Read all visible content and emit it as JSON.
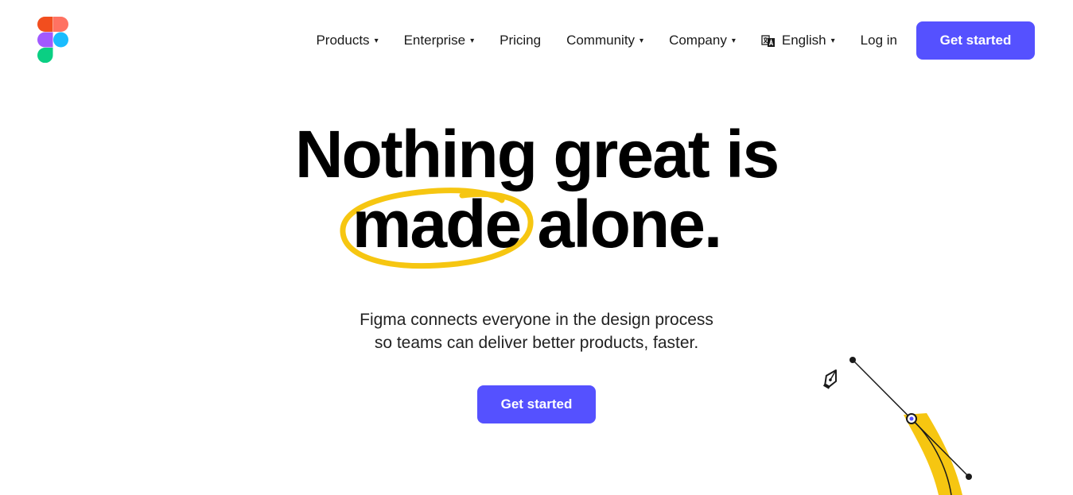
{
  "header": {
    "logo": {
      "name": "figma-logo"
    },
    "nav": {
      "products": "Products",
      "enterprise": "Enterprise",
      "pricing": "Pricing",
      "community": "Community",
      "company": "Company",
      "language": "English",
      "login": "Log in",
      "get_started": "Get started"
    },
    "caret": "▾"
  },
  "hero": {
    "headline_part1": "Nothing great is",
    "headline_circled": "made",
    "headline_part2": "alone.",
    "subtitle_line1": "Figma connects everyone in the design process",
    "subtitle_line2": "so teams can deliver better products, faster.",
    "cta_label": "Get started"
  },
  "colors": {
    "primary": "#5551ff",
    "highlight": "#f6c611",
    "logo_red": "#f24e1e",
    "logo_orange": "#ff7262",
    "logo_purple": "#a259ff",
    "logo_blue": "#1abcfe",
    "logo_green": "#0acf83"
  },
  "icons": [
    "figma-logo",
    "language-icon",
    "pen-tool-icon",
    "caret-down-icon"
  ]
}
